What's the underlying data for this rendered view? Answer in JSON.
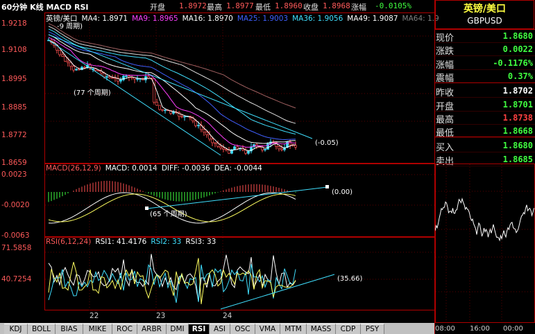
{
  "header": {
    "title": "60分钟 K线 MACD RSI",
    "open_label": "开盘",
    "open_value": "1.8972",
    "high_label": "最高",
    "high_value": "1.8977",
    "low_label": "最低",
    "low_value": "1.8960",
    "close_label": "收盘",
    "close_value": "1.8968",
    "change_label": "涨幅",
    "change_value": "-0.0105%"
  },
  "price_panel": {
    "legend": [
      {
        "text": "英镑/美口",
        "color": "#ffffff"
      },
      {
        "text": "MA4: 1.8971",
        "color": "#ffffff"
      },
      {
        "text": "MA9: 1.8965",
        "color": "#ff40ff"
      },
      {
        "text": "MA16: 1.8970",
        "color": "#ffffff"
      },
      {
        "text": "MA25: 1.9003",
        "color": "#4060ff"
      },
      {
        "text": "MA36: 1.9056",
        "color": "#40e0ff"
      },
      {
        "text": "MA49: 1.9087",
        "color": "#ffffff"
      },
      {
        "text": "MA64: 1.9",
        "color": "#808080"
      }
    ],
    "y_ticks": [
      "1.9218",
      "1.9108",
      "1.8995",
      "1.8885",
      "1.8772",
      "1.8659"
    ],
    "annotations": {
      "period_top": "-9 周期)",
      "period_77": "(77 个周期)",
      "trend_value": "(-0.05)"
    }
  },
  "macd_panel": {
    "legend": [
      {
        "text": "MACD(26,12,9)",
        "color": "#ff5a5a"
      },
      {
        "text": "MACD: 0.0014",
        "color": "#ffffff"
      },
      {
        "text": "DIFF: -0.0036",
        "color": "#ffffff"
      },
      {
        "text": "DEA: -0.0044",
        "color": "#ffffff"
      }
    ],
    "y_ticks": [
      "0.0023",
      "-0.0020",
      "-0.0063"
    ],
    "annotations": {
      "period_65": "(65 个周期)",
      "trend_value": "(0.00)"
    }
  },
  "rsi_panel": {
    "legend": [
      {
        "text": "RSI(6,12,24)",
        "color": "#ff5a5a"
      },
      {
        "text": "RSI1: 41.4176",
        "color": "#ffffff"
      },
      {
        "text": "RSI2: 33",
        "color": "#40e0ff"
      },
      {
        "text": "RSI3: 33",
        "color": "#ffffff"
      }
    ],
    "y_ticks": [
      "71.5858",
      "40.7254"
    ],
    "annotations": {
      "trend_value": "(35.66)"
    }
  },
  "x_axis": [
    "22",
    "23",
    "24"
  ],
  "tabs": [
    "KDJ",
    "BOLL",
    "BIAS",
    "MIKE",
    "ROC",
    "ARBR",
    "DMI",
    "RSI",
    "ASI",
    "OSC",
    "VMA",
    "MTM",
    "MASS",
    "CDP",
    "PSY"
  ],
  "active_tab": "RSI",
  "quote": {
    "name": "英镑/美口",
    "code": "GBPUSD",
    "rows": [
      {
        "k": "现价",
        "v": "1.8680",
        "color": "#40ff40"
      },
      {
        "k": "涨跌",
        "v": "0.0022",
        "color": "#40ff40"
      },
      {
        "k": "涨幅",
        "v": "-0.1176%",
        "color": "#40ff40"
      },
      {
        "k": "震幅",
        "v": "0.37%",
        "color": "#40ff40"
      },
      {
        "k": "昨收",
        "v": "1.8702",
        "color": "#ffffff"
      },
      {
        "k": "开盘",
        "v": "1.8701",
        "color": "#40ff40"
      },
      {
        "k": "最高",
        "v": "1.8738",
        "color": "#ff4040"
      },
      {
        "k": "最低",
        "v": "1.8668",
        "color": "#40ff40"
      },
      {
        "k": "买入",
        "v": "1.8680",
        "color": "#40ff40"
      },
      {
        "k": "卖出",
        "v": "1.8685",
        "color": "#40ff40"
      }
    ],
    "mini_x": [
      "08:00",
      "16:00",
      "00:00"
    ]
  }
}
